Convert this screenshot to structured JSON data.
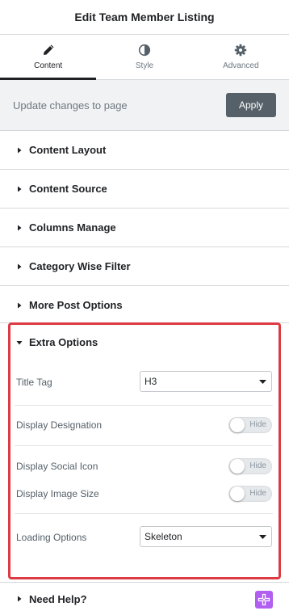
{
  "header": {
    "title": "Edit Team Member Listing"
  },
  "tabs": [
    {
      "label": "Content",
      "icon": "pencil-icon",
      "active": true
    },
    {
      "label": "Style",
      "icon": "half-circle-icon",
      "active": false
    },
    {
      "label": "Advanced",
      "icon": "gear-icon",
      "active": false
    }
  ],
  "update": {
    "text": "Update changes to page",
    "button_label": "Apply"
  },
  "sections": [
    {
      "label": "Content Layout"
    },
    {
      "label": "Content Source"
    },
    {
      "label": "Columns Manage"
    },
    {
      "label": "Category Wise Filter"
    },
    {
      "label": "More Post Options"
    }
  ],
  "extra_options": {
    "title": "Extra Options",
    "highlight_color": "#dc3b42",
    "title_tag": {
      "label": "Title Tag",
      "value": "H3"
    },
    "display_designation": {
      "label": "Display Designation",
      "toggle_label": "Hide",
      "on": false
    },
    "display_social_icon": {
      "label": "Display Social Icon",
      "toggle_label": "Hide",
      "on": false
    },
    "display_image_size": {
      "label": "Display Image Size",
      "toggle_label": "Hide",
      "on": false
    },
    "loading_options": {
      "label": "Loading Options",
      "value": "Skeleton"
    }
  },
  "help": {
    "label": "Need Help?",
    "icon": "help-plus-icon",
    "icon_color": "#b05ff0"
  }
}
